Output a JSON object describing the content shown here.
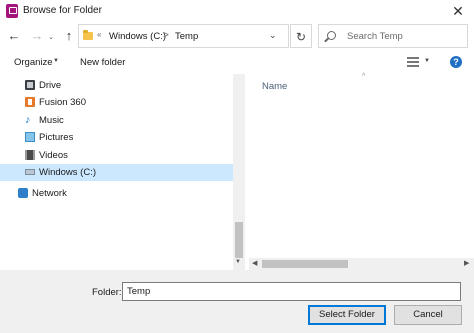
{
  "window": {
    "title": "Browse for Folder",
    "app_icon": "app-icon",
    "close_glyph": "✕"
  },
  "navigation": {
    "back_glyph": "←",
    "forward_glyph": "→",
    "recent_glyph": "⌄",
    "up_glyph": "↑",
    "address": {
      "overflow_glyph": "«",
      "breadcrumbs": [
        "Windows (C:)",
        "Temp"
      ],
      "separator": ">",
      "dropdown_glyph": "⌄"
    },
    "refresh_glyph": "↻",
    "search": {
      "placeholder": "Search Temp",
      "value": ""
    }
  },
  "toolbar": {
    "organize_label": "Organize",
    "organize_caret": "▼",
    "new_folder_label": "New folder",
    "view_caret": "▼",
    "help_label": "?"
  },
  "nav_pane": {
    "items": [
      {
        "label": "Drive",
        "icon": "drive-icon",
        "selected": false
      },
      {
        "label": "Fusion 360",
        "icon": "fusion-360-icon",
        "selected": false
      },
      {
        "label": "Music",
        "icon": "music-icon",
        "selected": false
      },
      {
        "label": "Pictures",
        "icon": "pictures-icon",
        "selected": false
      },
      {
        "label": "Videos",
        "icon": "videos-icon",
        "selected": false
      },
      {
        "label": "Windows (C:)",
        "icon": "windows-drive-icon",
        "selected": true
      },
      {
        "label": "Network",
        "icon": "network-icon",
        "selected": false
      }
    ]
  },
  "file_pane": {
    "column_header": "Name",
    "sort_glyph": "^"
  },
  "footer": {
    "folder_label": "Folder:",
    "folder_value": "Temp",
    "select_button": "Select Folder",
    "cancel_button": "Cancel"
  },
  "colors": {
    "selection": "#cce8ff",
    "accent": "#0078d7",
    "app_icon": "#a5147c",
    "help_icon": "#1f6fc5"
  }
}
